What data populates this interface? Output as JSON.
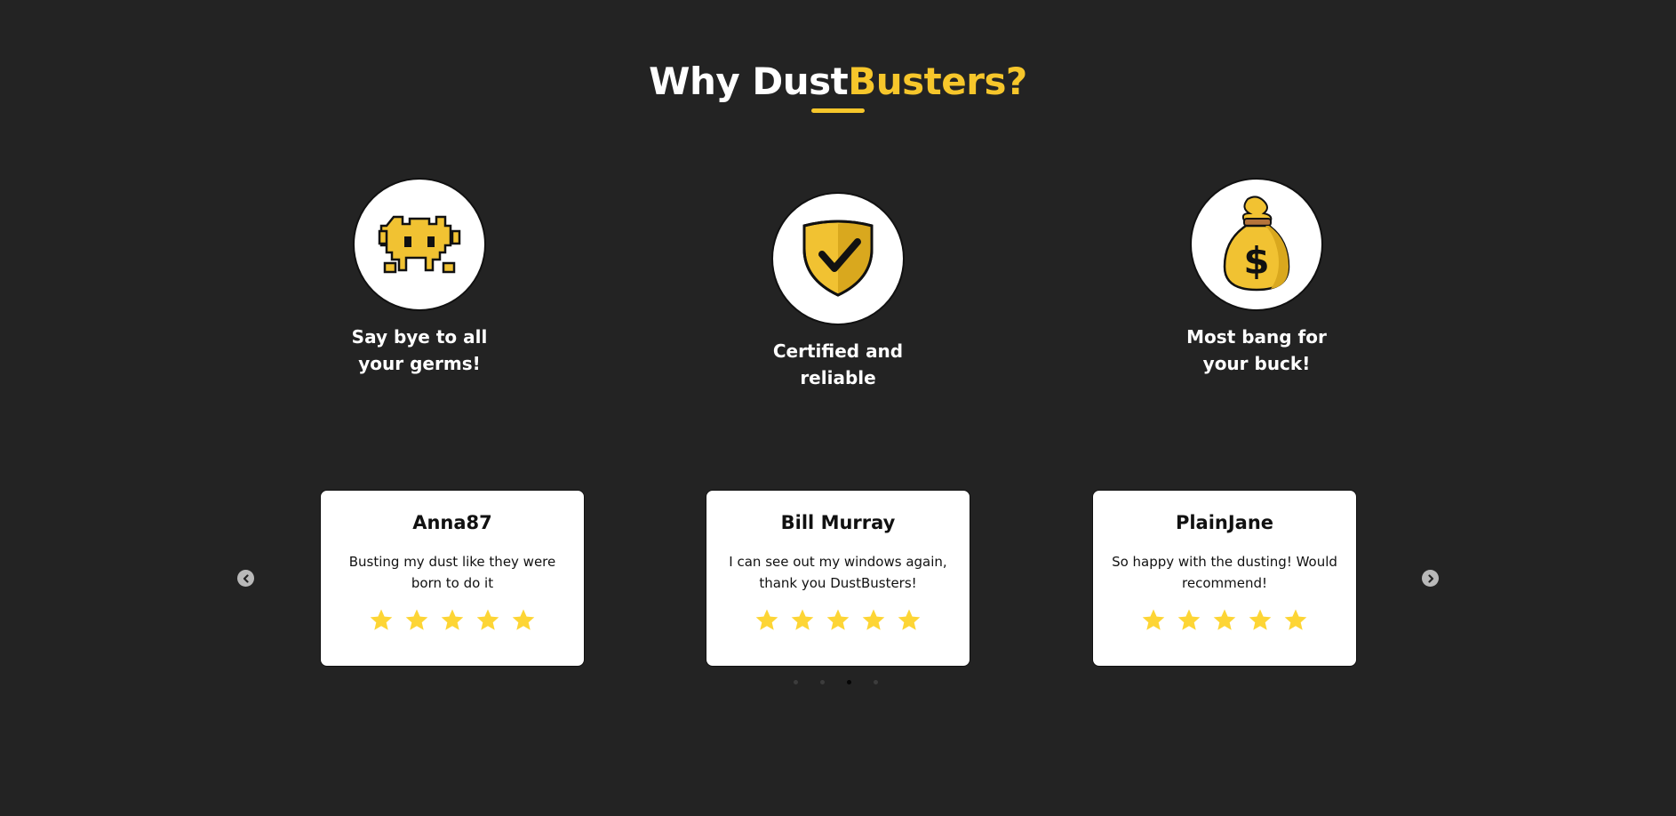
{
  "heading": {
    "part1": "Why Dust",
    "part2": "Busters?"
  },
  "features": [
    {
      "icon": "pixel-germ-icon",
      "label": "Say bye to all your germs!"
    },
    {
      "icon": "shield-check-icon",
      "label": "Certified and reliable"
    },
    {
      "icon": "money-bag-icon",
      "label": "Most bang for your buck!"
    }
  ],
  "testimonials": [
    {
      "name": "Anna87",
      "quote": "Busting my dust like they were born to do it",
      "rating": 5
    },
    {
      "name": "Bill Murray",
      "quote": "I can see out my windows again, thank you DustBusters!",
      "rating": 5
    },
    {
      "name": "PlainJane",
      "quote": "So happy with the dusting! Would recommend!",
      "rating": 5
    }
  ],
  "carousel": {
    "active_index": 2,
    "page_count": 4
  },
  "colors": {
    "background": "#232323",
    "accent": "#f6c62b",
    "star": "#fdd535",
    "card": "#ffffff"
  }
}
